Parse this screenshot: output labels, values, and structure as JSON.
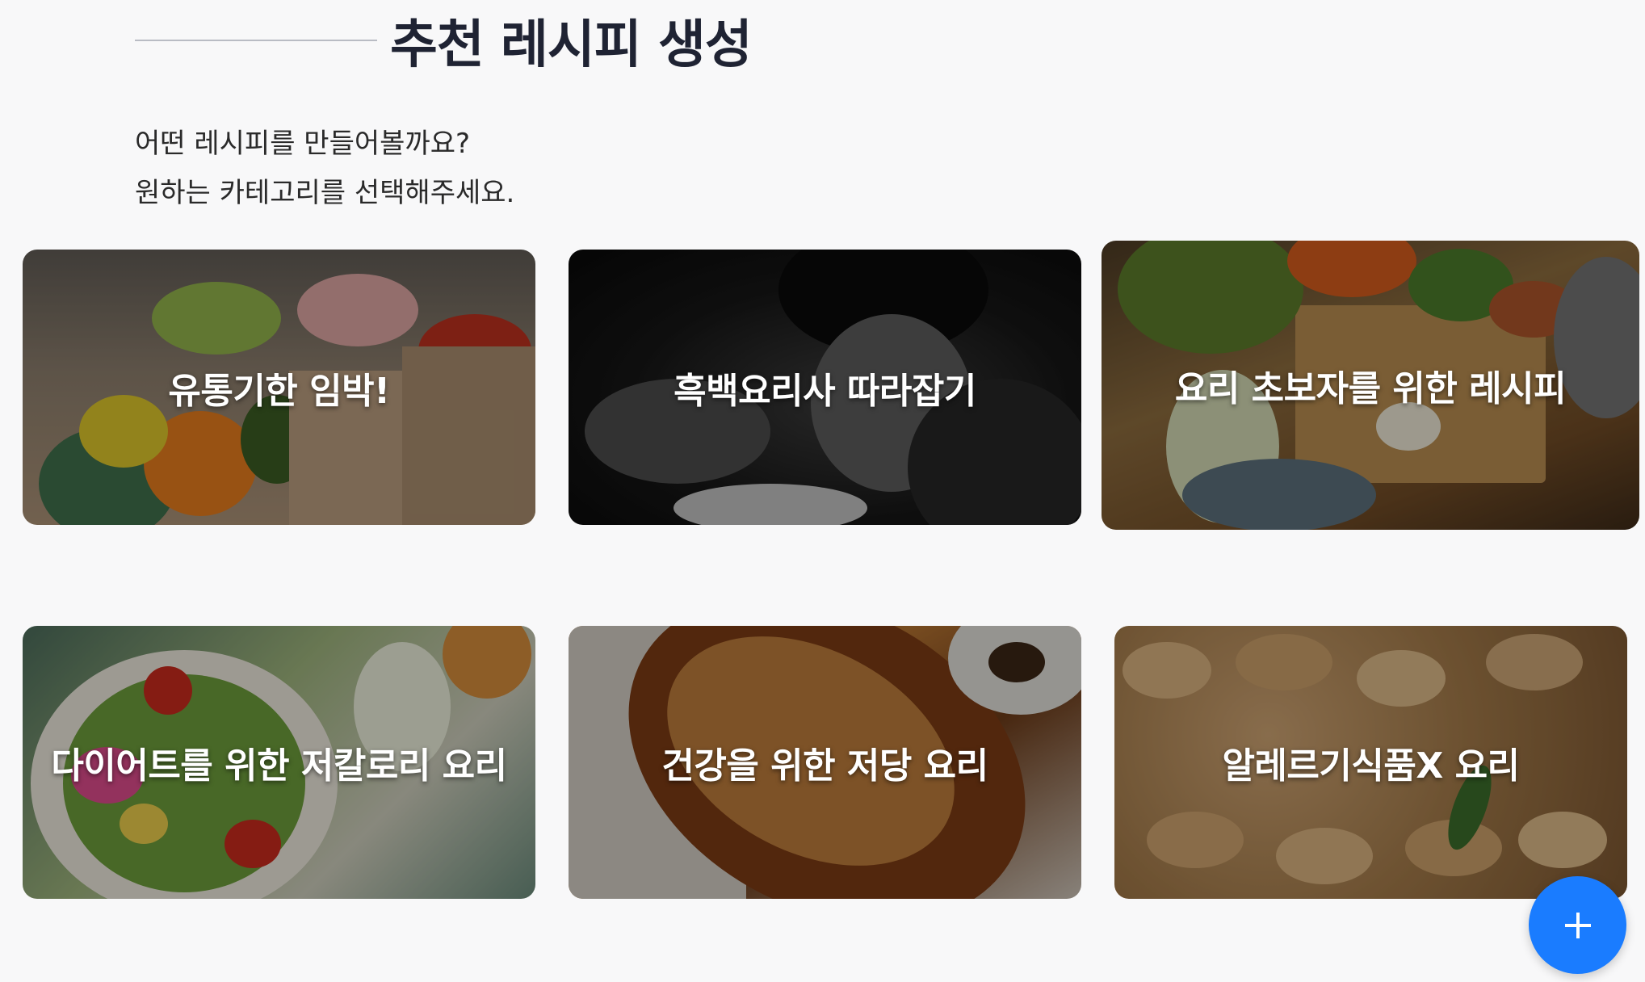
{
  "header": {
    "title": "추천 레시피 생성"
  },
  "intro": {
    "line1": "어떤 레시피를 만들어볼까요?",
    "line2": "원하는 카테고리를 선택해주세요."
  },
  "categories": [
    {
      "label": "유통기한 임박!"
    },
    {
      "label": "흑백요리사 따라잡기"
    },
    {
      "label": "요리 초보자를 위한 레시피"
    },
    {
      "label": "다이어트를 위한 저칼로리 요리"
    },
    {
      "label": "건강을 위한 저당 요리"
    },
    {
      "label": "알레르기식품X 요리"
    }
  ],
  "fab": {
    "icon": "plus-icon",
    "color": "#1a7cff"
  }
}
